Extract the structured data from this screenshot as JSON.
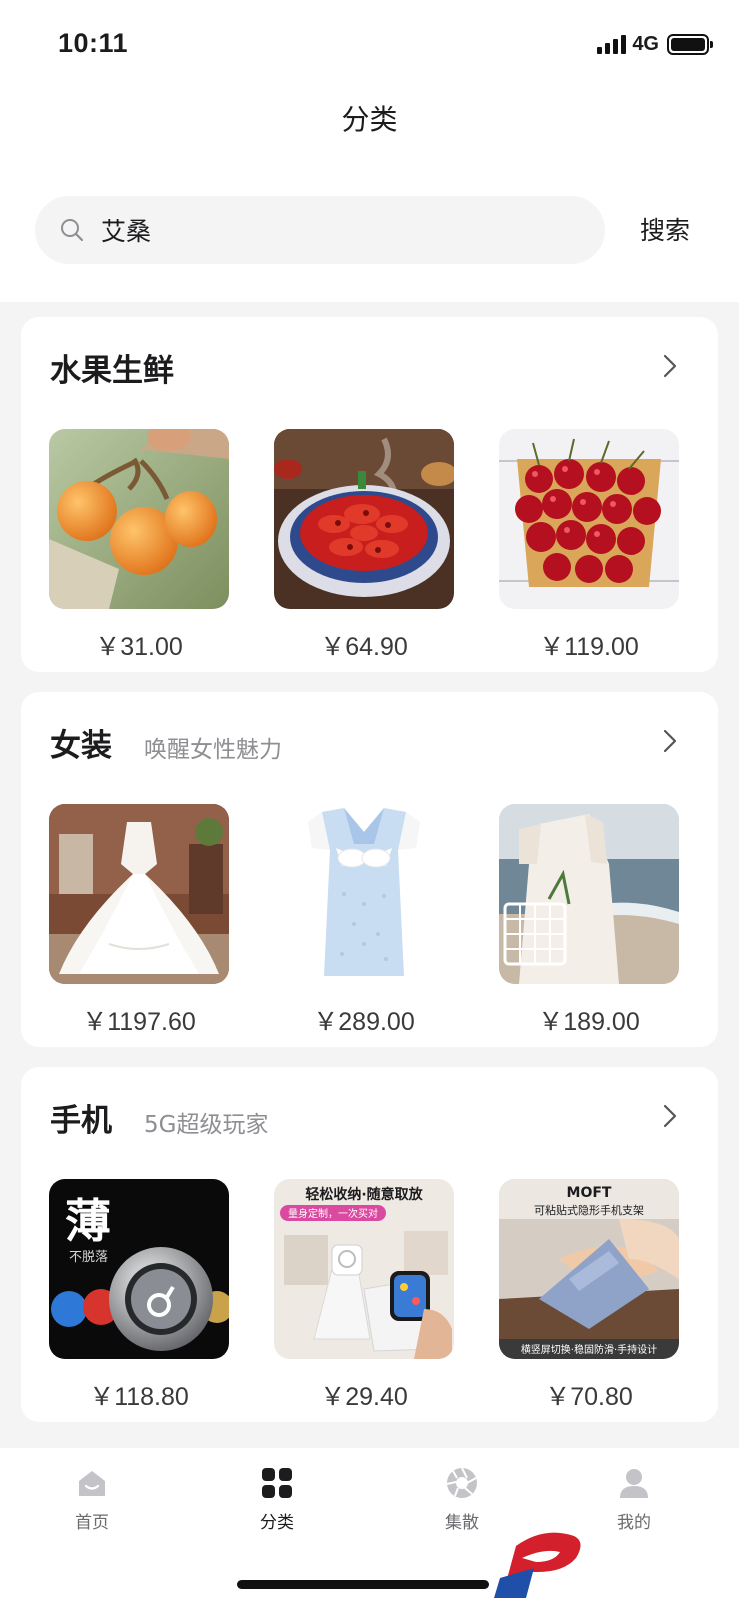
{
  "status_bar": {
    "time": "10:11",
    "network": "4G"
  },
  "header": {
    "title": "分类"
  },
  "search": {
    "value": "艾桑",
    "button_label": "搜索"
  },
  "sections": [
    {
      "title": "水果生鲜",
      "subtitle": "",
      "products": [
        {
          "price": "￥31.00",
          "image": "loquat-fruit"
        },
        {
          "price": "￥64.90",
          "image": "crayfish-plate"
        },
        {
          "price": "￥119.00",
          "image": "cherries-bowl"
        }
      ]
    },
    {
      "title": "女装",
      "subtitle": "唤醒女性魅力",
      "products": [
        {
          "price": "￥1197.60",
          "image": "wedding-dress"
        },
        {
          "price": "￥289.00",
          "image": "blue-sailor-dress"
        },
        {
          "price": "￥189.00",
          "image": "white-dress-beach"
        }
      ]
    },
    {
      "title": "手机",
      "subtitle": "5G超级玩家",
      "products": [
        {
          "price": "￥118.80",
          "image": "phone-ring-holder",
          "overlay": {
            "big": "薄",
            "small": "不脱落"
          }
        },
        {
          "price": "￥29.40",
          "image": "watch-charging-stand",
          "overlay": {
            "banner": "轻松收纳·随意取放",
            "tag": "量身定制，一次买对"
          }
        },
        {
          "price": "￥70.80",
          "image": "moft-phone-stand",
          "overlay": {
            "brand": "MOFT",
            "caption": "可粘贴式隐形手机支架",
            "footer": "横竖屏切换·稳固防滑·手持设计"
          }
        }
      ]
    }
  ],
  "tabbar": {
    "items": [
      {
        "label": "首页",
        "icon": "home-icon",
        "active": false
      },
      {
        "label": "分类",
        "icon": "category-grid-icon",
        "active": true
      },
      {
        "label": "集散",
        "icon": "aperture-icon",
        "active": false
      },
      {
        "label": "我的",
        "icon": "profile-icon",
        "active": false
      }
    ]
  },
  "colors": {
    "background": "#f4f4f5",
    "card": "#ffffff",
    "text_primary": "#1c1c1e",
    "text_secondary": "#8e8e93"
  }
}
